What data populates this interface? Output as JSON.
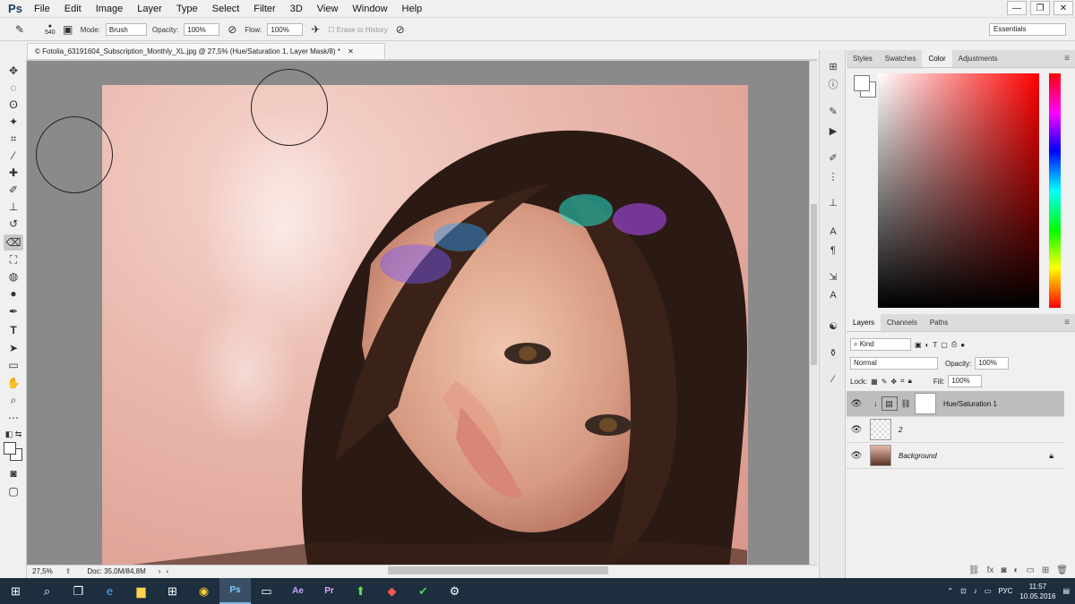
{
  "app": {
    "logo": "Ps",
    "menu": [
      "File",
      "Edit",
      "Image",
      "Layer",
      "Type",
      "Select",
      "Filter",
      "3D",
      "View",
      "Window",
      "Help"
    ],
    "window_controls": [
      "—",
      "❐",
      "✕"
    ]
  },
  "options_bar": {
    "brush_size": "540",
    "mode_label": "Mode:",
    "mode_value": "Brush",
    "opacity_label": "Opacity:",
    "opacity_value": "100%",
    "flow_label": "Flow:",
    "flow_value": "100%",
    "erase_history_label": "Erase to History",
    "workspace": "Essentials"
  },
  "document": {
    "tab_title": "© Fotolia_63191604_Subscription_Monthly_XL.jpg @ 27,5% (Hue/Saturation 1, Layer Mask/8) *",
    "zoom": "27,5%",
    "doc_info": "Doc: 35,0M/84,8M"
  },
  "color_panel": {
    "tabs": [
      "Styles",
      "Swatches",
      "Color",
      "Adjustments"
    ],
    "active_tab": "Color",
    "foreground": "#ffffff",
    "background": "#ffffff"
  },
  "layers_panel": {
    "tabs": [
      "Layers",
      "Channels",
      "Paths"
    ],
    "active_tab": "Layers",
    "filter": "Kind",
    "blend_mode": "Normal",
    "opacity_label": "Opacity:",
    "opacity_value": "100%",
    "lock_label": "Lock:",
    "fill_label": "Fill:",
    "fill_value": "100%",
    "layers": [
      {
        "name": "Hue/Saturation 1",
        "selected": true
      },
      {
        "name": "2",
        "selected": false
      },
      {
        "name": "Background",
        "selected": false,
        "locked": true
      }
    ]
  },
  "taskbar": {
    "language": "РУС",
    "time": "11:57",
    "date": "10.05.2016",
    "apps": [
      "start-icon",
      "search-icon",
      "task-view-icon",
      "edge-icon",
      "file-explorer-icon",
      "store-icon",
      "chrome-icon",
      "photoshop-icon",
      "scanner-icon",
      "after-effects-icon",
      "premiere-icon",
      "upload-icon",
      "app-icon",
      "app-icon-2",
      "settings-icon"
    ],
    "app_labels": {
      "ps": "Ps",
      "ae": "Ae",
      "pr": "Pr"
    }
  }
}
